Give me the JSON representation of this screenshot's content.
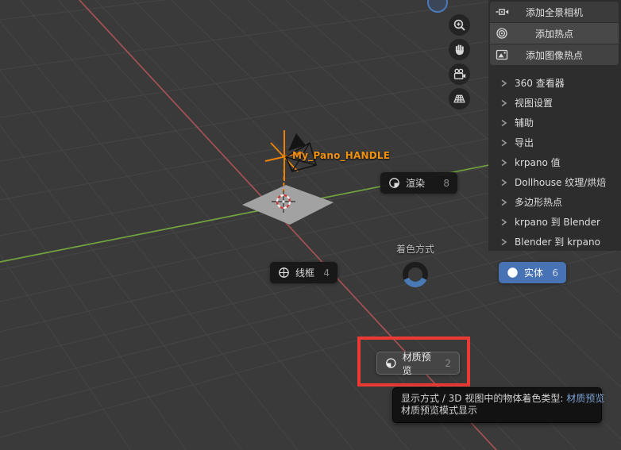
{
  "viewport": {
    "object_label": "My_Pano_HANDLE",
    "colors": {
      "background": "#3a3a3a",
      "grid_line": "#454545",
      "axis_x_red": "#a65153",
      "axis_y_green": "#71a43e",
      "accent_blue": "#4772b3",
      "object_orange": "#f29111",
      "highlight_red": "#ea3a33"
    },
    "nav_buttons": [
      {
        "icon": "zoom-in-icon"
      },
      {
        "icon": "pan-hand-icon"
      },
      {
        "icon": "camera-view-icon"
      },
      {
        "icon": "orthographic-grid-icon"
      }
    ]
  },
  "pie_menu": {
    "title": "着色方式",
    "items": [
      {
        "label": "渲染",
        "shortcut": "8",
        "icon": "rendered-sphere-icon",
        "state": "normal"
      },
      {
        "label": "线框",
        "shortcut": "4",
        "icon": "wireframe-sphere-icon",
        "state": "normal"
      },
      {
        "label": "实体",
        "shortcut": "6",
        "icon": "solid-sphere-icon",
        "state": "selected"
      },
      {
        "label": "材质预览",
        "shortcut": "2",
        "icon": "matpreview-sphere-icon",
        "state": "hovered"
      }
    ]
  },
  "tooltip": {
    "line1_prefix": "显示方式 / 3D 视图中的物体着色类型: ",
    "line1_highlight": "材质预览",
    "line2": "材质预览模式显示"
  },
  "sidebar": {
    "buttons": [
      {
        "label": "添加全景相机",
        "icon": "panorama-camera-icon"
      },
      {
        "label": "添加热点",
        "icon": "hotspot-icon"
      },
      {
        "label": "添加图像热点",
        "icon": "image-hotspot-icon"
      }
    ],
    "sections": [
      {
        "label": "360 查看器"
      },
      {
        "label": "视图设置"
      },
      {
        "label": "辅助"
      },
      {
        "label": "导出"
      },
      {
        "label": "krpano 值"
      },
      {
        "label": "Dollhouse 纹理/烘焙"
      },
      {
        "label": "多边形热点"
      },
      {
        "label": "krpano 到 Blender"
      },
      {
        "label": "Blender 到 krpano"
      }
    ]
  }
}
